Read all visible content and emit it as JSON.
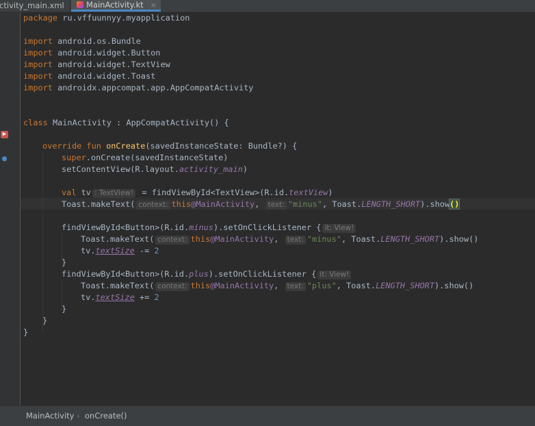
{
  "tabs": [
    {
      "label": "activity_main.xml"
    },
    {
      "label": "MainActivity.kt",
      "close": "×"
    }
  ],
  "code": {
    "l1": {
      "kw": "package",
      "text": " ru.vffuunnyy.myapplication"
    },
    "l3": {
      "kw": "import",
      "text": " android.os.Bundle"
    },
    "l4": {
      "kw": "import",
      "text": " android.widget.Button"
    },
    "l5": {
      "kw": "import",
      "text": " android.widget.TextView"
    },
    "l6": {
      "kw": "import",
      "text": " android.widget.Toast"
    },
    "l7": {
      "kw": "import",
      "text": " androidx.appcompat.app.AppCompatActivity"
    },
    "l10": {
      "kw": "class",
      "text": " MainActivity : AppCompatActivity() {"
    },
    "l12": {
      "kw": "override fun",
      "fn": "onCreate",
      "text": "(savedInstanceState: Bundle?) {"
    },
    "l13": {
      "kw": "super",
      "text": ".onCreate(savedInstanceState)"
    },
    "l14": {
      "pre": "setContentView(R.layout.",
      "it": "activity_main",
      "post": ")"
    },
    "l16": {
      "kw": "val",
      "name": " tv",
      "hint": ": TextView!",
      "mid": " = findViewById<TextView>(R.id.",
      "it": "textView",
      "post": ")"
    },
    "l17": {
      "pre": "Toast.makeText(",
      "hint1": "context:",
      "kw": "this",
      "lbl": "@MainActivity",
      "sep": ",",
      "hint2": "text:",
      "str": "\"minus\"",
      "mid": ", Toast.",
      "it": "LENGTH_SHORT",
      "post": ").show",
      "brace": "()"
    },
    "l19": {
      "pre": "findViewById<Button>(R.id.",
      "it": "minus",
      "post": ").setOnClickListener {",
      "hint": "it: View!"
    },
    "l20": {
      "pre": "Toast.makeText(",
      "hint1": "context:",
      "kw": "this",
      "lbl": "@MainActivity",
      "sep": ",",
      "hint2": "text:",
      "str": "\"minus\"",
      "mid": ", Toast.",
      "it": "LENGTH_SHORT",
      "post": ").show()"
    },
    "l21": {
      "pre": "tv.",
      "it": "textSize",
      "mid": " -= ",
      "num": "2"
    },
    "l22": {
      "text": "}"
    },
    "l23": {
      "pre": "findViewById<Button>(R.id.",
      "it": "plus",
      "post": ").setOnClickListener {",
      "hint": "it: View!"
    },
    "l24": {
      "pre": "Toast.makeText(",
      "hint1": "context:",
      "kw": "this",
      "lbl": "@MainActivity",
      "sep": ",",
      "hint2": "text:",
      "str": "\"plus\"",
      "mid": ", Toast.",
      "it": "LENGTH_SHORT",
      "post": ").show()"
    },
    "l25": {
      "pre": "tv.",
      "it": "textSize",
      "mid": " += ",
      "num": "2"
    },
    "l26": {
      "text": "}"
    },
    "l27": {
      "text": "}"
    },
    "l28": {
      "text": "}"
    }
  },
  "breadcrumb": {
    "class": "MainActivity",
    "separator": "›",
    "method": "onCreate()"
  },
  "colors": {
    "background": "#2b2b2b",
    "keyword": "#cc7832",
    "function": "#ffc66d",
    "string": "#6a8759",
    "number": "#6897bb",
    "field": "#9876aa"
  },
  "gutter_icons": [
    "run-class-icon",
    "override-method-icon"
  ]
}
